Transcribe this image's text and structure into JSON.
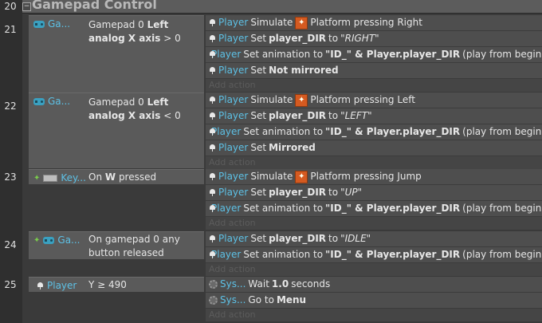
{
  "group": {
    "number": "20",
    "title": "Gamepad Control"
  },
  "add_action_label": "Add action",
  "events": [
    {
      "number": "21",
      "condition": {
        "object": "Ga...",
        "icon": "gamepad-icon",
        "text_pre": "Gamepad 0 ",
        "text_bold": "Left analog X axis",
        "text_post": " > 0"
      },
      "actions": [
        {
          "obj": "Player",
          "pre": "Simulate ",
          "behavior_icon": true,
          "mid": "Platform pressing Right",
          "bold": "",
          "post": "",
          "ital": ""
        },
        {
          "obj": "Player",
          "pre": "Set ",
          "bold": "player_DIR",
          "mid": " to ",
          "ital": "\"RIGHT\"",
          "post": ""
        },
        {
          "obj": "Player",
          "pre": "Set animation to ",
          "bold": "\"ID_\" & Player.player_DIR",
          "mid": "",
          "ital": "",
          "post": " (play from beginning)"
        },
        {
          "obj": "Player",
          "pre": "Set ",
          "bold": "Not mirrored",
          "mid": "",
          "ital": "",
          "post": ""
        }
      ]
    },
    {
      "number": "22",
      "condition": {
        "object": "Ga...",
        "icon": "gamepad-icon",
        "text_pre": "Gamepad 0 ",
        "text_bold": "Left analog X axis",
        "text_post": " < 0"
      },
      "actions": [
        {
          "obj": "Player",
          "pre": "Simulate ",
          "behavior_icon": true,
          "mid": "Platform pressing Left",
          "bold": "",
          "post": "",
          "ital": ""
        },
        {
          "obj": "Player",
          "pre": "Set ",
          "bold": "player_DIR",
          "mid": " to ",
          "ital": "\"LEFT\"",
          "post": ""
        },
        {
          "obj": "Player",
          "pre": "Set animation to ",
          "bold": "\"ID_\" & Player.player_DIR",
          "mid": "",
          "ital": "",
          "post": " (play from beginning)"
        },
        {
          "obj": "Player",
          "pre": "Set ",
          "bold": "Mirrored",
          "mid": "",
          "ital": "",
          "post": ""
        }
      ]
    },
    {
      "number": "23",
      "condition": {
        "object": "Key...",
        "icon": "keyboard-icon",
        "text_pre": "On ",
        "text_bold": "W",
        "text_post": " pressed"
      },
      "actions": [
        {
          "obj": "Player",
          "pre": "Simulate ",
          "behavior_icon": true,
          "mid": "Platform pressing Jump",
          "bold": "",
          "post": "",
          "ital": ""
        },
        {
          "obj": "Player",
          "pre": "Set ",
          "bold": "player_DIR",
          "mid": " to ",
          "ital": "\"UP\"",
          "post": ""
        },
        {
          "obj": "Player",
          "pre": "Set animation to ",
          "bold": "\"ID_\" & Player.player_DIR",
          "mid": "",
          "ital": "",
          "post": " (play from beginning)"
        }
      ]
    },
    {
      "number": "24",
      "condition": {
        "object": "Ga...",
        "icon": "gamepad-icon",
        "text_pre": "On gamepad 0 any button released",
        "text_bold": "",
        "text_post": ""
      },
      "actions": [
        {
          "obj": "Player",
          "pre": "Set ",
          "bold": "player_DIR",
          "mid": " to ",
          "ital": "\"IDLE\"",
          "post": ""
        },
        {
          "obj": "Player",
          "pre": "Set animation to ",
          "bold": "\"ID_\" & Player.player_DIR",
          "mid": "",
          "ital": "",
          "post": " (play from beginning)"
        }
      ]
    },
    {
      "number": "25",
      "condition": {
        "object": "Player",
        "icon": "sprite-icon",
        "text_pre": "Y ≥ 490",
        "text_bold": "",
        "text_post": ""
      },
      "actions": [
        {
          "obj": "Sys...",
          "system": true,
          "pre": "Wait ",
          "bold": "1.0",
          "mid": "",
          "ital": "",
          "post": " seconds"
        },
        {
          "obj": "Sys...",
          "system": true,
          "pre": "Go to ",
          "bold": "Menu",
          "mid": "",
          "ital": "",
          "post": ""
        }
      ]
    }
  ]
}
